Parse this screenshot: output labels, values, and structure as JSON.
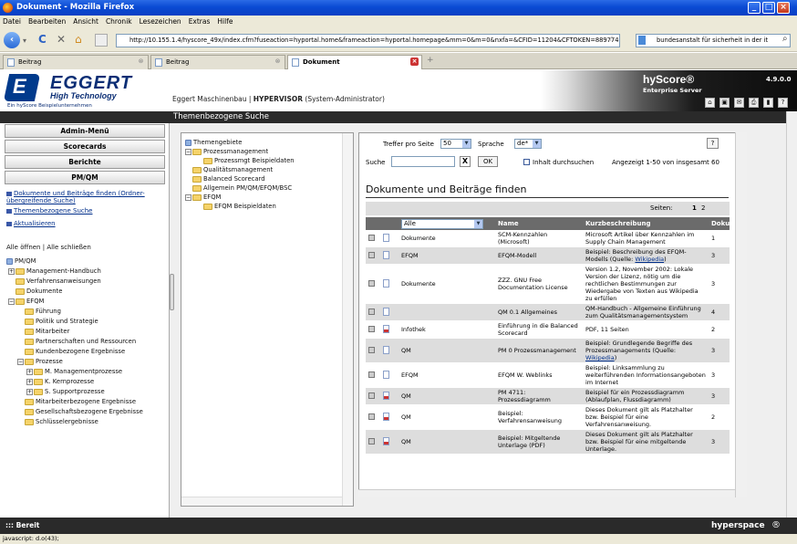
{
  "window": {
    "title": "Dokument - Mozilla Firefox"
  },
  "menubar": [
    "Datei",
    "Bearbeiten",
    "Ansicht",
    "Chronik",
    "Lesezeichen",
    "Extras",
    "Hilfe"
  ],
  "navbar": {
    "url": "http://10.155.1.4/hyscore_49x/index.cfm?fuseaction=hyportal.home&frameaction=hyportal.homepage&mm=0&m=0&nxfa=&CFID=11204&CFTOKEN=88977475",
    "search": "bundesanstalt für sicherheit in der it"
  },
  "tabs": [
    {
      "label": "Beitrag"
    },
    {
      "label": "Beitrag"
    },
    {
      "label": "Dokument"
    }
  ],
  "header": {
    "logo_text": "EGGERT",
    "logo_subtitle": "High Technology",
    "logo_caption": "Ein hyScore Beispielunternehmen",
    "company_prefix": "Eggert Maschinenbau | ",
    "company_role": "HYPERVISOR",
    "company_suffix": "  (System-Administrator)",
    "brand": "hyScore®",
    "brand_sub": "Enterprise Server",
    "version": "4.9.0.0"
  },
  "left": {
    "nav_buttons": [
      "Admin-Menü",
      "Scorecards",
      "Berichte",
      "PM/QM"
    ],
    "links": [
      "Dokumente und Beiträge finden (Ordner-übergreifende Suche)",
      "Themenbezogene Suche",
      "Aktualisieren"
    ],
    "toggle_open": "Alle öffnen",
    "toggle_sep": " | ",
    "toggle_close": "Alle schließen",
    "tree_root": "PM/QM",
    "tree": [
      "Management-Handbuch",
      "Verfahrensanweisungen",
      "Dokumente",
      "EFQM",
      "Führung",
      "Politik und Strategie",
      "Mitarbeiter",
      "Partnerschaften und Ressourcen",
      "Kundenbezogene Ergebnisse",
      "Prozesse",
      "M. Managementprozesse",
      "K. Kernprozesse",
      "S. Supportprozesse",
      "Mitarbeiterbezogene Ergebnisse",
      "Gesellschaftsbezogene Ergebnisse",
      "Schlüsselergebnisse"
    ]
  },
  "center": {
    "title": "Themenbezogene Suche",
    "theme_root": "Themengebiete",
    "theme_tree": [
      "Prozessmanagement",
      "Prozessmgt Beispieldaten",
      "Qualitätsmanagement",
      "Balanced Scorecard",
      "Allgemein PM/QM/EFQM/BSC",
      "EFQM",
      "EFQM Beispieldaten"
    ]
  },
  "docs": {
    "per_page_label": "Treffer pro Seite",
    "per_page_value": "50",
    "lang_label": "Sprache",
    "lang_value": "de*",
    "help": "?",
    "search_label": "Suche",
    "clear": "X",
    "ok": "OK",
    "content_search_label": "Inhalt durchsuchen",
    "count_text": "Angezeigt 1-50 von insgesamt 60",
    "heading": "Dokumente und Beiträge finden",
    "pages_label": "Seiten:",
    "page1": "1",
    "page2": "2",
    "filter_value": "Alle",
    "col_name": "Name",
    "col_desc": "Kurzbeschreibung",
    "col_doku": "Dokum",
    "rows": [
      {
        "cat": "Dokumente",
        "name": "SCM-Kennzahlen (Microsoft)",
        "desc": "Microsoft Artikel über Kennzahlen im Supply Chain Management",
        "desc_link": "",
        "num": "1",
        "pdf": false
      },
      {
        "cat": "EFQM",
        "name": "EFQM-Modell",
        "desc": "Beispiel: Beschreibung des EFQM-Modells (Quelle: ",
        "desc_link": "Wikipedia",
        "num": "3",
        "pdf": false
      },
      {
        "cat": "Dokumente",
        "name": "ZZZ. GNU Free Documentation License",
        "desc": "Version 1.2, November 2002: Lokale Version der Lizenz, nötig um die rechtlichen Bestimmungen zur Wiedergabe von Texten aus Wikipedia zu erfüllen",
        "desc_link": "",
        "num": "3",
        "pdf": false
      },
      {
        "cat": "",
        "name": "QM 0.1 Allgemeines",
        "desc": "QM-Handbuch - Allgemeine Einführung zum Qualitätsmanagementsystem",
        "desc_link": "",
        "num": "4",
        "pdf": false
      },
      {
        "cat": "Infothek",
        "name": "Einführung in die Balanced Scorecard",
        "desc": "PDF, 11 Seiten",
        "desc_link": "",
        "num": "2",
        "pdf": true
      },
      {
        "cat": "QM",
        "name": "PM 0 Prozessmanagement",
        "desc": "Beispiel: Grundlegende Begriffe des Prozessmanagements (Quelle: ",
        "desc_link": "Wikipedia",
        "num": "3",
        "pdf": false
      },
      {
        "cat": "EFQM",
        "name": "EFQM W. Weblinks",
        "desc": "Beispiel: Linksammlung zu weiterführenden Informationsangeboten im Internet",
        "desc_link": "",
        "num": "3",
        "pdf": false
      },
      {
        "cat": "QM",
        "name": "PM 4711: Prozessdiagramm",
        "desc": "Beispiel für ein Prozessdiagramm (Ablaufplan, Flussdiagramm)",
        "desc_link": "",
        "num": "3",
        "pdf": true
      },
      {
        "cat": "QM",
        "name": "Beispiel: Verfahrensanweisung",
        "desc": "Dieses Dokument gilt als Platzhalter bzw. Beispiel für eine Verfahrensanweisung.",
        "desc_link": "",
        "num": "2",
        "pdf": true
      },
      {
        "cat": "QM",
        "name": "Beispiel: Mitgeltende Unterlage (PDF)",
        "desc": "Dieses Dokument gilt als Platzhalter bzw. Beispiel für eine mitgeltende Unterlage.",
        "desc_link": "",
        "num": "3",
        "pdf": true
      }
    ]
  },
  "footer": {
    "status": "::: Bereit",
    "brand": "hyperspace"
  },
  "statusbar": {
    "text": "javascript: d.o(43);"
  }
}
